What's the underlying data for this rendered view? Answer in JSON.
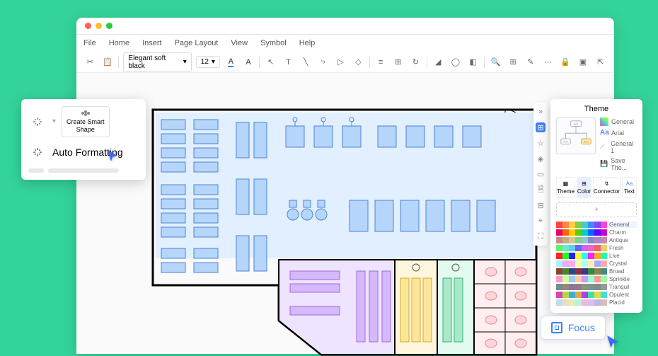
{
  "menu": {
    "file": "File",
    "home": "Home",
    "insert": "Insert",
    "pageLayout": "Page Layout",
    "view": "View",
    "symbol": "Symbol",
    "help": "Help"
  },
  "toolbar": {
    "font": "Elegant soft black",
    "size": "12"
  },
  "popover": {
    "create": "Create Smart\nShape",
    "auto": "Auto Formatting"
  },
  "theme": {
    "title": "Theme",
    "opts": {
      "general": "General",
      "arial": "Arial",
      "general1": "General 1",
      "save": "Save The..."
    },
    "tabs": {
      "theme": "Theme",
      "color": "Color",
      "connector": "Connector",
      "text": "Text"
    },
    "palettes": [
      "General",
      "Charm",
      "Antique",
      "Fresh",
      "Live",
      "Crystal",
      "Broad",
      "Sprinkle",
      "Tranquil",
      "Opulent",
      "Placid"
    ]
  },
  "focus": {
    "label": "Focus"
  }
}
